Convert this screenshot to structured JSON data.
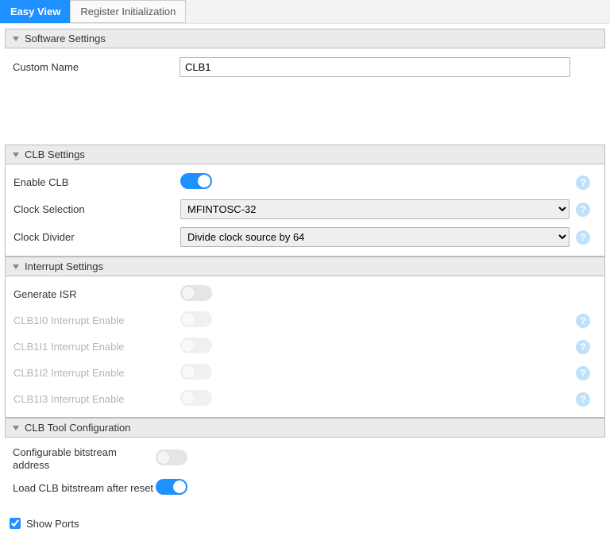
{
  "tabs": {
    "easy_view": "Easy View",
    "register_init": "Register Initialization"
  },
  "sections": {
    "software": "Software Settings",
    "clb": "CLB Settings",
    "interrupt": "Interrupt Settings",
    "tool": "CLB Tool Configuration"
  },
  "software": {
    "custom_name_label": "Custom Name",
    "custom_name_value": "CLB1"
  },
  "clb": {
    "enable_label": "Enable CLB",
    "enable_on": true,
    "clock_selection_label": "Clock Selection",
    "clock_selection_value": "MFINTOSC-32",
    "clock_divider_label": "Clock Divider",
    "clock_divider_value": "Divide clock source by 64"
  },
  "interrupt": {
    "generate_isr_label": "Generate ISR",
    "i0_label": "CLB1I0 Interrupt Enable",
    "i1_label": "CLB1I1 Interrupt Enable",
    "i2_label": "CLB1I2 Interrupt Enable",
    "i3_label": "CLB1I3 Interrupt Enable"
  },
  "tool": {
    "configurable_bitstream_label": "Configurable bitstream address",
    "load_bitstream_label": "Load CLB bitstream after reset"
  },
  "show_ports_label": "Show Ports",
  "help_glyph": "?"
}
